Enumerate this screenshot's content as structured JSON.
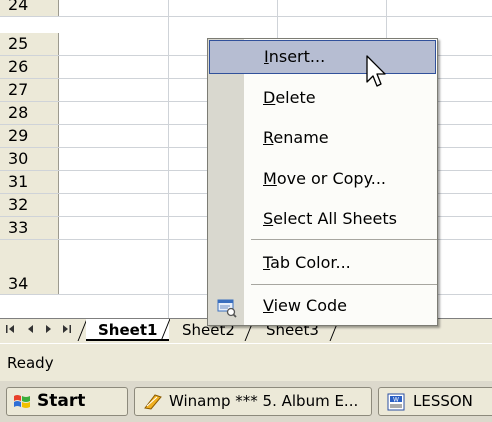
{
  "grid": {
    "rows": [
      "24",
      "25",
      "26",
      "27",
      "28",
      "29",
      "30",
      "31",
      "32",
      "33",
      "34"
    ]
  },
  "tabs": {
    "nav_first": "◀◀",
    "nav_prev": "◀",
    "nav_next": "▶",
    "nav_last": "▶|",
    "sheets": [
      {
        "label": "Sheet1",
        "active": true
      },
      {
        "label": "Sheet2",
        "active": false
      },
      {
        "label": "Sheet3",
        "active": false
      }
    ]
  },
  "status": {
    "text": "Ready"
  },
  "taskbar": {
    "start_label": "Start",
    "tasks": [
      {
        "label": "Winamp *** 5. Album E..."
      },
      {
        "label": "LESSON"
      }
    ]
  },
  "context_menu": {
    "items": [
      {
        "accel": "I",
        "rest": "nsert...",
        "highlighted": true
      },
      {
        "accel": "D",
        "rest": "elete"
      },
      {
        "accel": "R",
        "rest": "ename"
      },
      {
        "accel": "M",
        "rest": "ove or Copy..."
      },
      {
        "accel": "S",
        "rest": "elect All Sheets"
      },
      {
        "accel": "T",
        "rest": "ab Color..."
      },
      {
        "accel": "V",
        "rest": "iew Code",
        "icon": "view-code-icon"
      }
    ]
  },
  "colors": {
    "highlight_bg": "#b6bdd2",
    "highlight_border": "#31519b",
    "chrome": "#ece9d8"
  }
}
